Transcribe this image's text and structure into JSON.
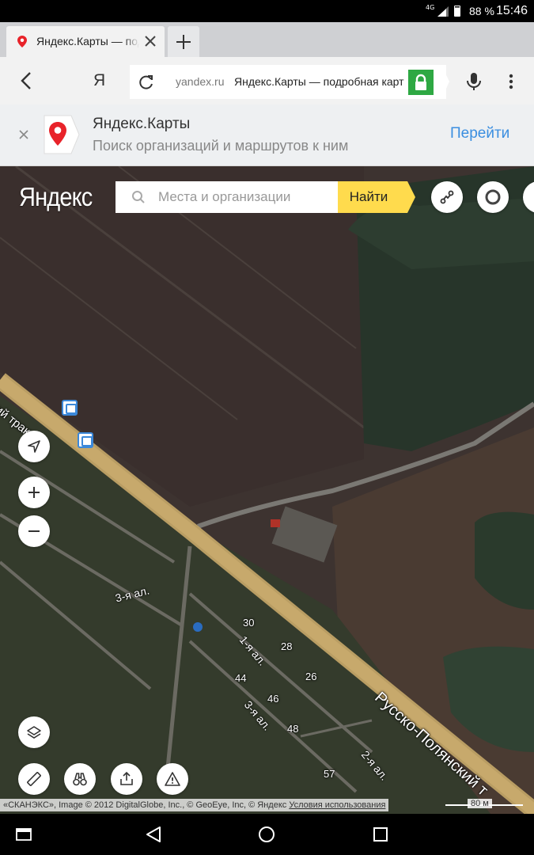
{
  "status_bar": {
    "network": "4G",
    "battery": "88 %",
    "time": "15:46"
  },
  "tab": {
    "title": "Яндекс.Карты — подробная",
    "pin_icon": "map-pin-icon",
    "close_icon": "close-icon",
    "new_tab_icon": "plus-icon"
  },
  "address_bar": {
    "ya_label": "Я",
    "domain": "yandex.ru",
    "page_title": "Яндекс.Карты — подробная карта",
    "secure_color": "#2ea843"
  },
  "banner": {
    "app_name": "Яндекс.Карты",
    "description": "Поиск организаций и маршрутов к ним",
    "open_label": "Перейти",
    "link_color": "#3a8ee0"
  },
  "map": {
    "logo": "Яндекс",
    "search_placeholder": "Места и организации",
    "find_label": "Найти",
    "accent": "#ffdb4d",
    "streets": {
      "tract_left": "ский тракт",
      "tract_right": "Русско-Полянский т",
      "alley_3_left": "3-я ал.",
      "alley_1": "1-я ал.",
      "alley_3_right": "3-я ал.",
      "alley_2": "2-я ал."
    },
    "houses": [
      "30",
      "28",
      "26",
      "44",
      "46",
      "48",
      "57"
    ],
    "copyright": "«СКАНЭКС», Image © 2012 DigitalGlobe, Inc., © GeoEye, Inc, © Яндекс",
    "terms": "Условия использования",
    "scale": "80 м"
  }
}
